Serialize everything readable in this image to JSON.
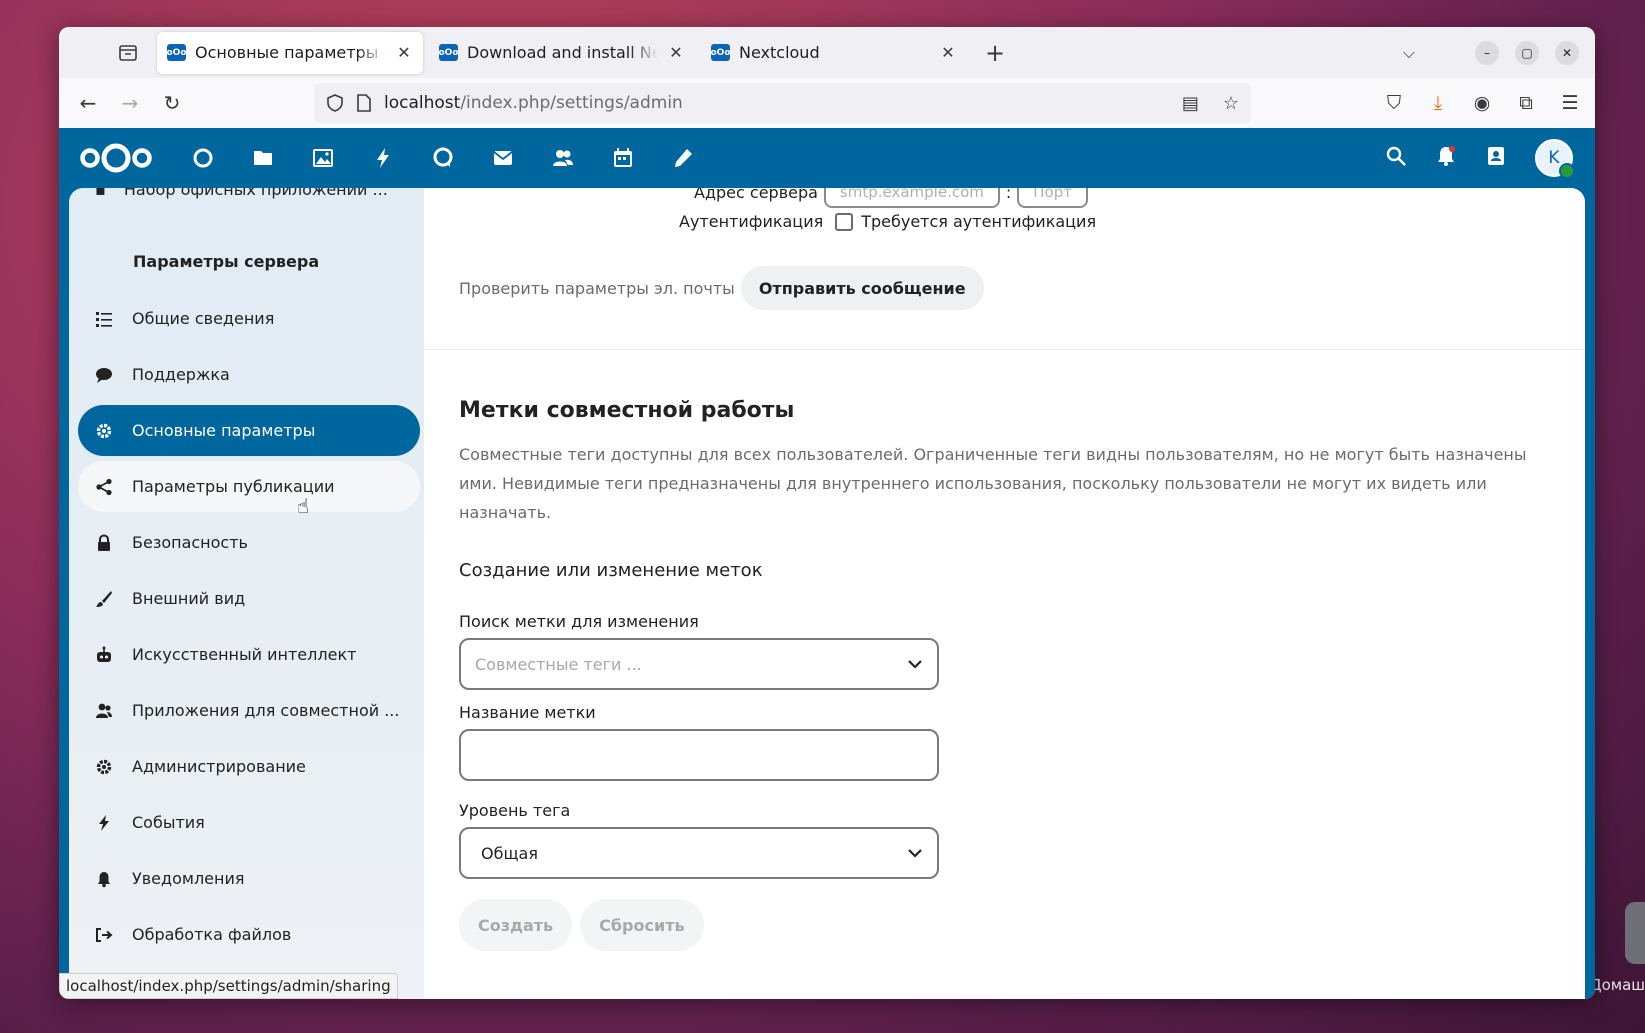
{
  "browser": {
    "tabs": [
      {
        "title": "Основные параметры - Nextcloud",
        "active": true
      },
      {
        "title": "Download and install Nextcloud",
        "active": false
      },
      {
        "title": "Nextcloud",
        "active": false
      }
    ],
    "url_host": "localhost",
    "url_path": "/index.php/settings/admin",
    "status_url": "localhost/index.php/settings/admin/sharing"
  },
  "header": {
    "avatar_letter": "K",
    "apps": [
      "dashboard-icon",
      "files-icon",
      "photos-icon",
      "activity-icon",
      "talk-icon",
      "mail-icon",
      "contacts-icon",
      "calendar-icon",
      "notes-icon"
    ]
  },
  "sidebar": {
    "top_partial": "Набор офисных приложений ...",
    "caption": "Параметры сервера",
    "items": [
      {
        "label": "Общие сведения",
        "icon": "list-icon"
      },
      {
        "label": "Поддержка",
        "icon": "chat-bubble-icon"
      },
      {
        "label": "Основные параметры",
        "icon": "gear-icon",
        "active": true
      },
      {
        "label": "Параметры публикации",
        "icon": "share-icon",
        "hover": true
      },
      {
        "label": "Безопасность",
        "icon": "lock-icon"
      },
      {
        "label": "Внешний вид",
        "icon": "brush-icon"
      },
      {
        "label": "Искусственный интеллект",
        "icon": "robot-icon"
      },
      {
        "label": "Приложения для совместной ...",
        "icon": "people-icon"
      },
      {
        "label": "Администрирование",
        "icon": "gear-cog-icon"
      },
      {
        "label": "События",
        "icon": "flash-icon"
      },
      {
        "label": "Уведомления",
        "icon": "bell-icon"
      },
      {
        "label": "Обработка файлов",
        "icon": "file-process-icon"
      }
    ]
  },
  "main": {
    "server_label": "Адрес сервера",
    "server_placeholder": "smtp.example.com",
    "port_placeholder": "Порт",
    "auth_label": "Аутентификация",
    "auth_checkbox": "Требуется аутентификация",
    "test_label": "Проверить параметры эл. почты",
    "send_button": "Отправить сообщение",
    "section_title": "Метки совместной работы",
    "section_desc": "Совместные теги доступны для всех пользователей. Ограниченные теги видны пользователям, но не могут быть назначены ими. Невидимые теги предназначены для внутреннего использования, поскольку пользователи не могут их видеть или назначать.",
    "subsection": "Создание или изменение меток",
    "search_label": "Поиск метки для изменения",
    "search_placeholder": "Совместные теги ...",
    "name_label": "Название метки",
    "name_value": "",
    "level_label": "Уровень тега",
    "level_value": "Общая",
    "create_button": "Создать",
    "reset_button": "Сбросить"
  },
  "desktop": {
    "label": "Домаш"
  },
  "colors": {
    "brand": "#00679e",
    "download": "#e66c1e",
    "online": "#2d9a39"
  }
}
